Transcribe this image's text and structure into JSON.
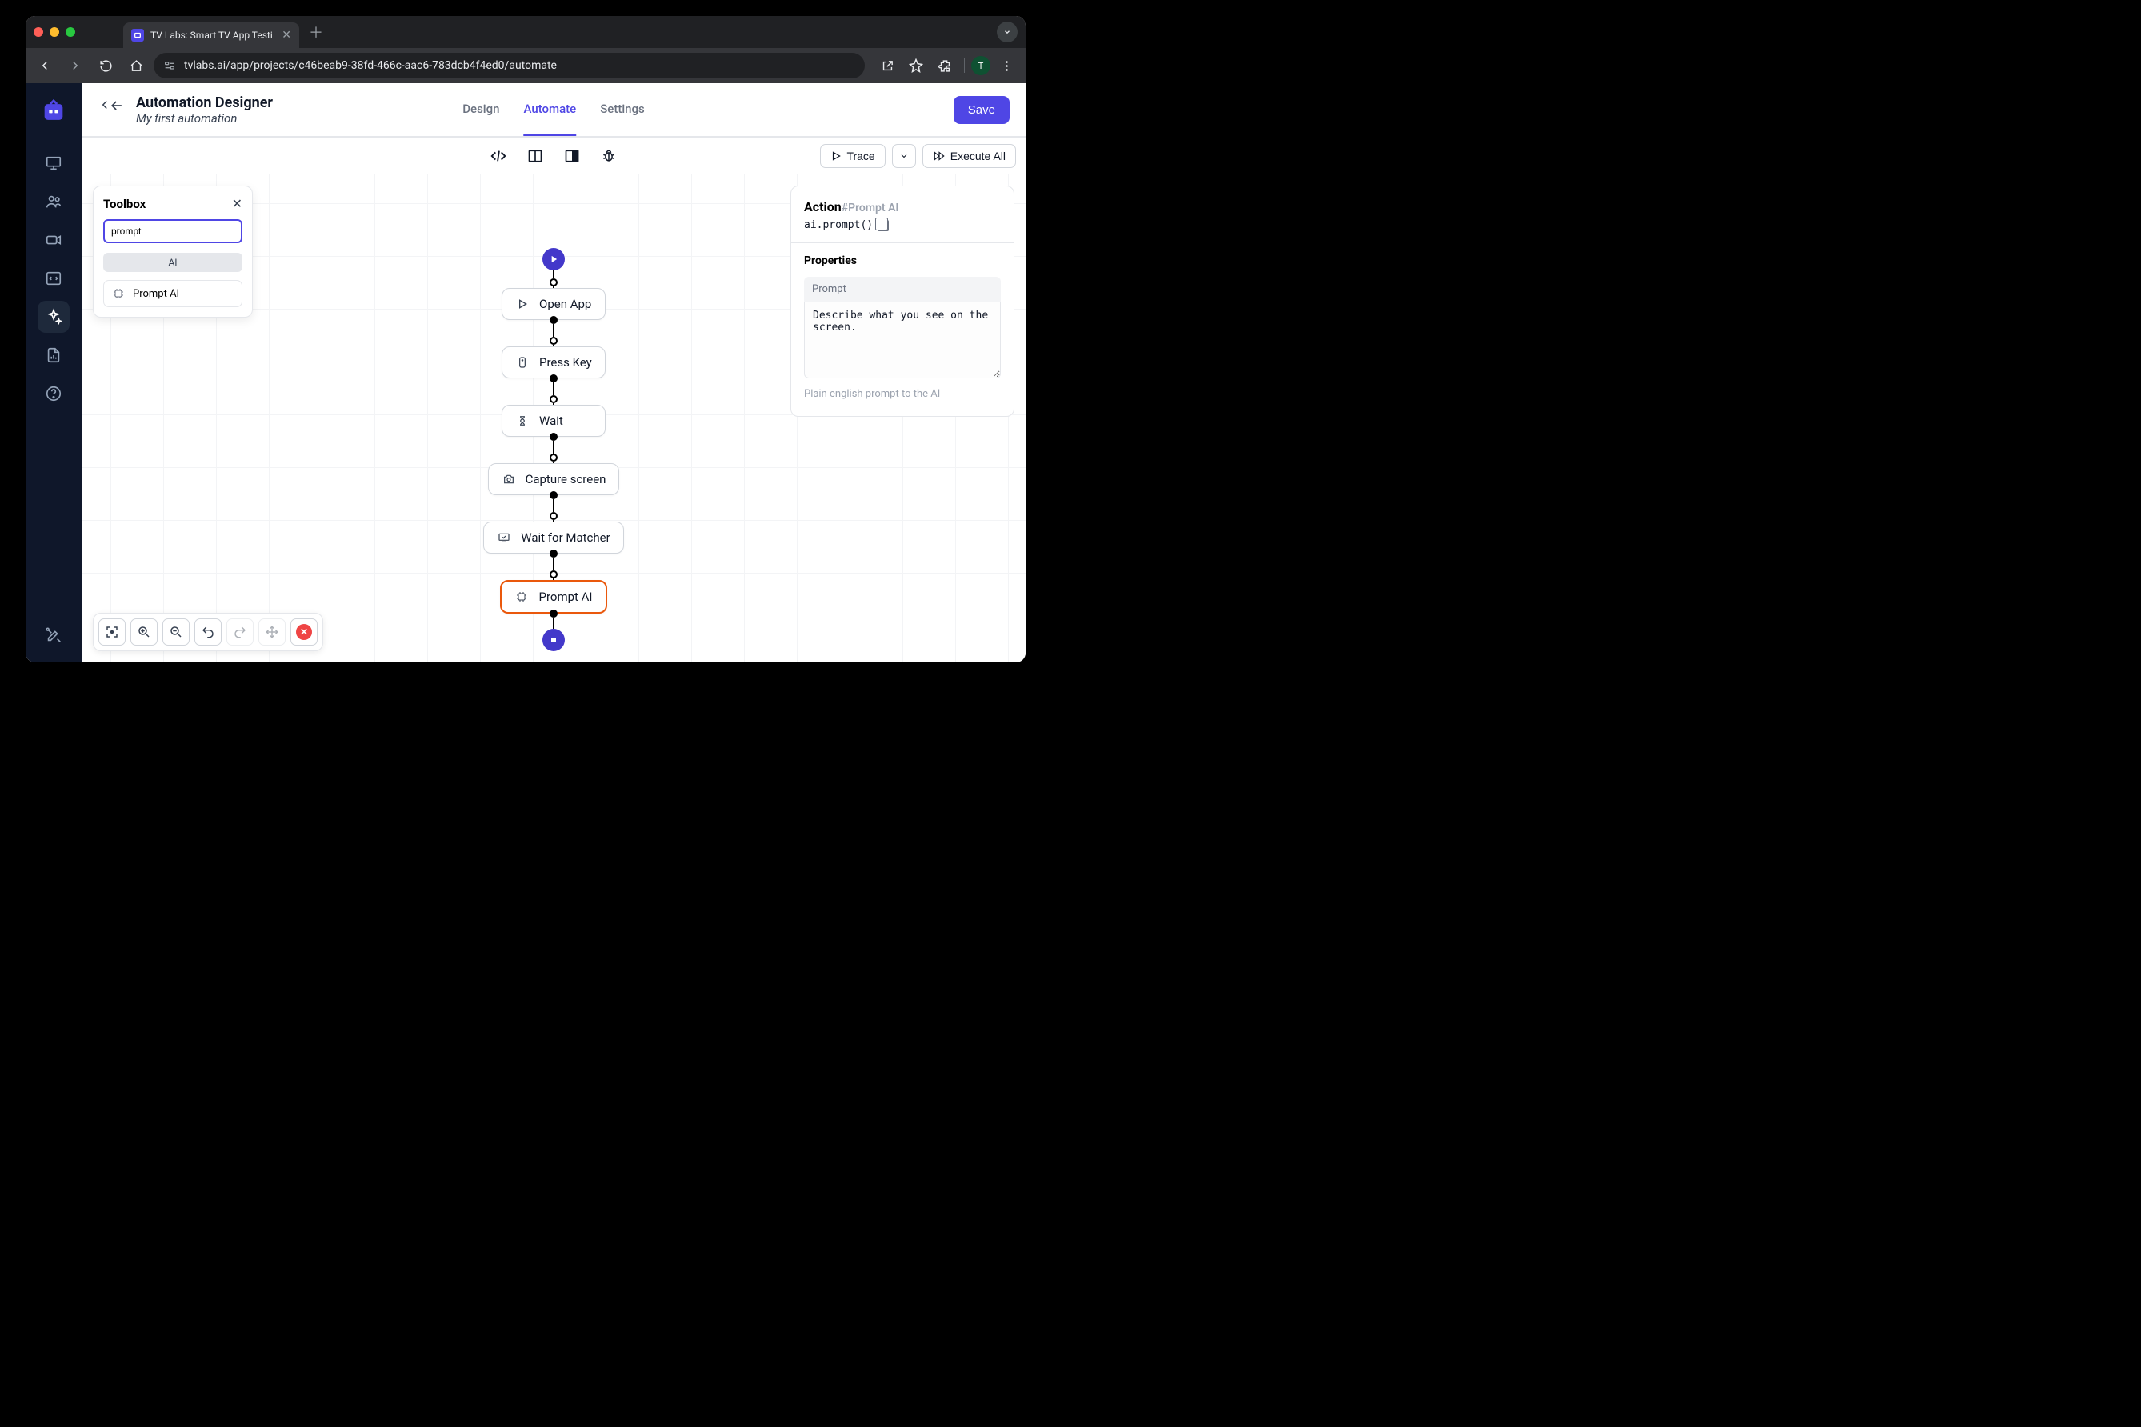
{
  "browser": {
    "tab_title": "TV Labs: Smart TV App Testi",
    "url": "tvlabs.ai/app/projects/c46beab9-38fd-466c-aac6-783dcb4f4ed0/automate",
    "avatar_initial": "T"
  },
  "header": {
    "back": "←",
    "title": "Automation Designer",
    "subtitle": "My first automation",
    "tabs": {
      "design": "Design",
      "automate": "Automate",
      "settings": "Settings"
    },
    "save": "Save"
  },
  "secondbar": {
    "trace": "Trace",
    "execute_all": "Execute All"
  },
  "toolbox": {
    "title": "Toolbox",
    "search_value": "prompt",
    "category": "AI",
    "item": "Prompt AI"
  },
  "flow": {
    "nodes": [
      {
        "label": "Open App"
      },
      {
        "label": "Press Key"
      },
      {
        "label": "Wait"
      },
      {
        "label": "Capture screen"
      },
      {
        "label": "Wait for Matcher"
      },
      {
        "label": "Prompt AI"
      }
    ]
  },
  "props": {
    "heading": "Action",
    "hash": "#Prompt AI",
    "code": "ai.prompt()",
    "section": "Properties",
    "field_label": "Prompt",
    "field_value": "Describe what you see on the screen.",
    "field_help": "Plain english prompt to the AI"
  }
}
